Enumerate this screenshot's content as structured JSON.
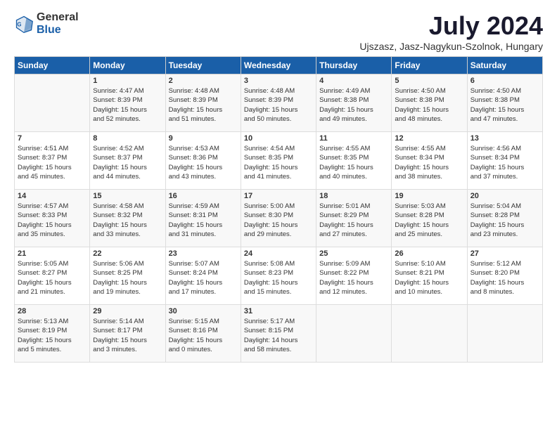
{
  "logo": {
    "general": "General",
    "blue": "Blue"
  },
  "title": "July 2024",
  "subtitle": "Ujszasz, Jasz-Nagykun-Szolnok, Hungary",
  "columns": [
    "Sunday",
    "Monday",
    "Tuesday",
    "Wednesday",
    "Thursday",
    "Friday",
    "Saturday"
  ],
  "weeks": [
    [
      {
        "day": "",
        "info": ""
      },
      {
        "day": "1",
        "info": "Sunrise: 4:47 AM\nSunset: 8:39 PM\nDaylight: 15 hours\nand 52 minutes."
      },
      {
        "day": "2",
        "info": "Sunrise: 4:48 AM\nSunset: 8:39 PM\nDaylight: 15 hours\nand 51 minutes."
      },
      {
        "day": "3",
        "info": "Sunrise: 4:48 AM\nSunset: 8:39 PM\nDaylight: 15 hours\nand 50 minutes."
      },
      {
        "day": "4",
        "info": "Sunrise: 4:49 AM\nSunset: 8:38 PM\nDaylight: 15 hours\nand 49 minutes."
      },
      {
        "day": "5",
        "info": "Sunrise: 4:50 AM\nSunset: 8:38 PM\nDaylight: 15 hours\nand 48 minutes."
      },
      {
        "day": "6",
        "info": "Sunrise: 4:50 AM\nSunset: 8:38 PM\nDaylight: 15 hours\nand 47 minutes."
      }
    ],
    [
      {
        "day": "7",
        "info": "Sunrise: 4:51 AM\nSunset: 8:37 PM\nDaylight: 15 hours\nand 45 minutes."
      },
      {
        "day": "8",
        "info": "Sunrise: 4:52 AM\nSunset: 8:37 PM\nDaylight: 15 hours\nand 44 minutes."
      },
      {
        "day": "9",
        "info": "Sunrise: 4:53 AM\nSunset: 8:36 PM\nDaylight: 15 hours\nand 43 minutes."
      },
      {
        "day": "10",
        "info": "Sunrise: 4:54 AM\nSunset: 8:35 PM\nDaylight: 15 hours\nand 41 minutes."
      },
      {
        "day": "11",
        "info": "Sunrise: 4:55 AM\nSunset: 8:35 PM\nDaylight: 15 hours\nand 40 minutes."
      },
      {
        "day": "12",
        "info": "Sunrise: 4:55 AM\nSunset: 8:34 PM\nDaylight: 15 hours\nand 38 minutes."
      },
      {
        "day": "13",
        "info": "Sunrise: 4:56 AM\nSunset: 8:34 PM\nDaylight: 15 hours\nand 37 minutes."
      }
    ],
    [
      {
        "day": "14",
        "info": "Sunrise: 4:57 AM\nSunset: 8:33 PM\nDaylight: 15 hours\nand 35 minutes."
      },
      {
        "day": "15",
        "info": "Sunrise: 4:58 AM\nSunset: 8:32 PM\nDaylight: 15 hours\nand 33 minutes."
      },
      {
        "day": "16",
        "info": "Sunrise: 4:59 AM\nSunset: 8:31 PM\nDaylight: 15 hours\nand 31 minutes."
      },
      {
        "day": "17",
        "info": "Sunrise: 5:00 AM\nSunset: 8:30 PM\nDaylight: 15 hours\nand 29 minutes."
      },
      {
        "day": "18",
        "info": "Sunrise: 5:01 AM\nSunset: 8:29 PM\nDaylight: 15 hours\nand 27 minutes."
      },
      {
        "day": "19",
        "info": "Sunrise: 5:03 AM\nSunset: 8:28 PM\nDaylight: 15 hours\nand 25 minutes."
      },
      {
        "day": "20",
        "info": "Sunrise: 5:04 AM\nSunset: 8:28 PM\nDaylight: 15 hours\nand 23 minutes."
      }
    ],
    [
      {
        "day": "21",
        "info": "Sunrise: 5:05 AM\nSunset: 8:27 PM\nDaylight: 15 hours\nand 21 minutes."
      },
      {
        "day": "22",
        "info": "Sunrise: 5:06 AM\nSunset: 8:25 PM\nDaylight: 15 hours\nand 19 minutes."
      },
      {
        "day": "23",
        "info": "Sunrise: 5:07 AM\nSunset: 8:24 PM\nDaylight: 15 hours\nand 17 minutes."
      },
      {
        "day": "24",
        "info": "Sunrise: 5:08 AM\nSunset: 8:23 PM\nDaylight: 15 hours\nand 15 minutes."
      },
      {
        "day": "25",
        "info": "Sunrise: 5:09 AM\nSunset: 8:22 PM\nDaylight: 15 hours\nand 12 minutes."
      },
      {
        "day": "26",
        "info": "Sunrise: 5:10 AM\nSunset: 8:21 PM\nDaylight: 15 hours\nand 10 minutes."
      },
      {
        "day": "27",
        "info": "Sunrise: 5:12 AM\nSunset: 8:20 PM\nDaylight: 15 hours\nand 8 minutes."
      }
    ],
    [
      {
        "day": "28",
        "info": "Sunrise: 5:13 AM\nSunset: 8:19 PM\nDaylight: 15 hours\nand 5 minutes."
      },
      {
        "day": "29",
        "info": "Sunrise: 5:14 AM\nSunset: 8:17 PM\nDaylight: 15 hours\nand 3 minutes."
      },
      {
        "day": "30",
        "info": "Sunrise: 5:15 AM\nSunset: 8:16 PM\nDaylight: 15 hours\nand 0 minutes."
      },
      {
        "day": "31",
        "info": "Sunrise: 5:17 AM\nSunset: 8:15 PM\nDaylight: 14 hours\nand 58 minutes."
      },
      {
        "day": "",
        "info": ""
      },
      {
        "day": "",
        "info": ""
      },
      {
        "day": "",
        "info": ""
      }
    ]
  ]
}
